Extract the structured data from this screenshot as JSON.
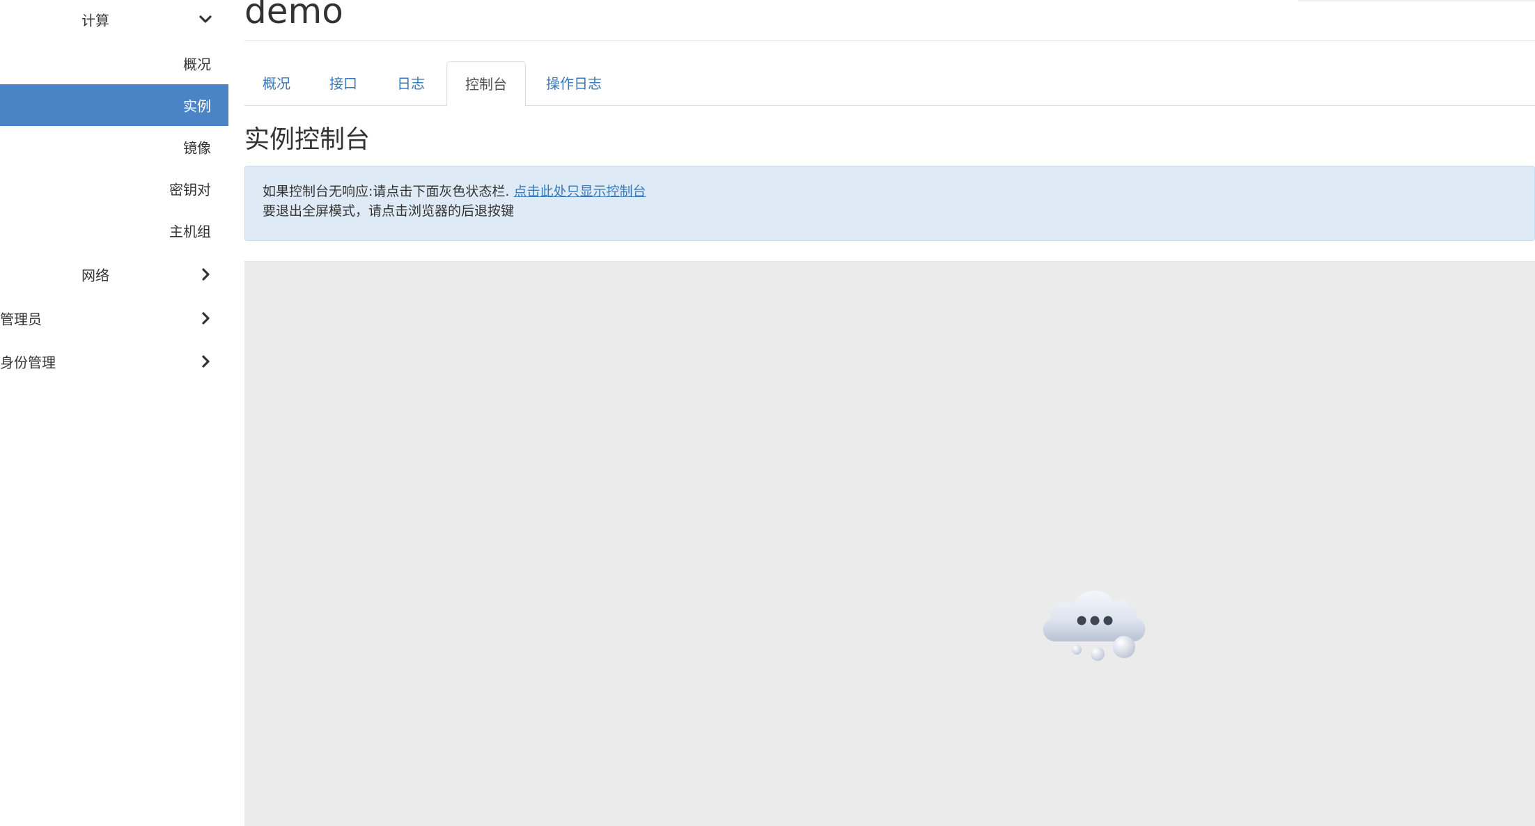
{
  "sidebar": {
    "compute": {
      "label": "计算",
      "icon": "chevron-down-icon"
    },
    "compute_items": [
      {
        "label": "概况",
        "active": false
      },
      {
        "label": "实例",
        "active": true
      },
      {
        "label": "镜像",
        "active": false
      },
      {
        "label": "密钥对",
        "active": false
      },
      {
        "label": "主机组",
        "active": false
      }
    ],
    "network": {
      "label": "网络",
      "icon": "chevron-right-icon"
    },
    "admin": {
      "label": "管理员",
      "icon": "chevron-right-icon"
    },
    "identity": {
      "label": "身份管理",
      "icon": "chevron-right-icon"
    }
  },
  "main": {
    "title": "demo",
    "tabs": [
      {
        "label": "概况",
        "active": false
      },
      {
        "label": "接口",
        "active": false
      },
      {
        "label": "日志",
        "active": false
      },
      {
        "label": "控制台",
        "active": true
      },
      {
        "label": "操作日志",
        "active": false
      }
    ],
    "section_title": "实例控制台",
    "info": {
      "line1_text": "如果控制台无响应:请点击下面灰色状态栏. ",
      "line1_link": "点击此处只显示控制台",
      "line2_text": "要退出全屏模式，请点击浏览器的后退按键"
    },
    "console": {
      "loading_icon": "cloud-loading-icon"
    }
  },
  "colors": {
    "accent": "#4a84c6",
    "link": "#3a78b8",
    "info_bg": "#deebf7",
    "console_bg": "#ebebeb"
  }
}
